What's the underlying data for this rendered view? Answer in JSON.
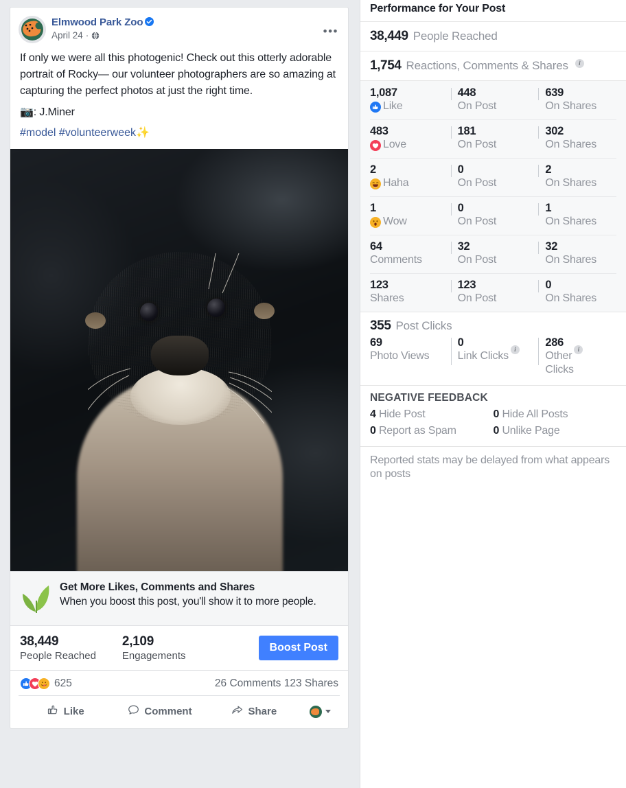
{
  "post": {
    "page_name": "Elmwood Park Zoo",
    "verified_icon": "verified-badge-icon",
    "date": "April 24",
    "separator": "·",
    "privacy_icon": "globe-icon",
    "menu_icon": "ellipsis-icon",
    "body": "If only we were all this photogenic! Check out this otterly adorable portrait of Rocky— our volunteer photographers are so amazing at capturing the perfect photos at just the right time.",
    "credit": "📷: J.Miner",
    "hashtags": "#model #volunteerweek✨",
    "photo_alt": "otter-portrait-photo"
  },
  "boost_promo": {
    "icon": "leaf-sprout-icon",
    "title": "Get More Likes, Comments and Shares",
    "subtitle": "When you boost this post, you'll show it to more people."
  },
  "summary": {
    "reach_value": "38,449",
    "reach_label": "People Reached",
    "engagements_value": "2,109",
    "engagements_label": "Engagements",
    "boost_button": "Boost Post"
  },
  "reactions_bar": {
    "icons": [
      "like-reaction-icon",
      "love-reaction-icon",
      "care-reaction-icon"
    ],
    "count": "625",
    "comments_shares": "26 Comments 123 Shares"
  },
  "actions": [
    {
      "label": "Like",
      "icon": "thumbs-up-outline-icon"
    },
    {
      "label": "Comment",
      "icon": "comment-bubble-icon"
    },
    {
      "label": "Share",
      "icon": "share-arrow-icon"
    }
  ],
  "action_avatar": {
    "icon": "profile-avatar-icon",
    "caret": "chevron-down-icon"
  },
  "insights": {
    "title": "Performance for Your Post",
    "reach": {
      "value": "38,449",
      "label": "People Reached"
    },
    "engagement": {
      "value": "1,754",
      "label": "Reactions, Comments & Shares",
      "info_icon": "info-icon"
    },
    "col_labels": {
      "on_post": "On Post",
      "on_shares": "On Shares"
    },
    "breakdown": [
      {
        "icon": "like-reaction-icon",
        "total": "1,087",
        "label": "Like",
        "on_post": "448",
        "on_shares": "639"
      },
      {
        "icon": "love-reaction-icon",
        "total": "483",
        "label": "Love",
        "on_post": "181",
        "on_shares": "302"
      },
      {
        "icon": "haha-reaction-icon",
        "total": "2",
        "label": "Haha",
        "on_post": "0",
        "on_shares": "2"
      },
      {
        "icon": "wow-reaction-icon",
        "total": "1",
        "label": "Wow",
        "on_post": "0",
        "on_shares": "1"
      },
      {
        "icon": null,
        "total": "64",
        "label": "Comments",
        "on_post": "32",
        "on_shares": "32"
      },
      {
        "icon": null,
        "total": "123",
        "label": "Shares",
        "on_post": "123",
        "on_shares": "0"
      }
    ],
    "clicks": {
      "total": "355",
      "label": "Post Clicks",
      "items": [
        {
          "value": "69",
          "label": "Photo Views",
          "info": false
        },
        {
          "value": "0",
          "label": "Link Clicks",
          "info": true
        },
        {
          "value": "286",
          "label_part1": "Other",
          "label_part2": "Clicks",
          "info": true
        }
      ]
    },
    "negative_feedback": {
      "title": "NEGATIVE FEEDBACK",
      "items": [
        {
          "value": "4",
          "label": "Hide Post"
        },
        {
          "value": "0",
          "label": "Hide All Posts"
        },
        {
          "value": "0",
          "label": "Report as Spam"
        },
        {
          "value": "0",
          "label": "Unlike Page"
        }
      ]
    },
    "note": "Reported stats may be delayed from what appears on posts"
  },
  "colors": {
    "brand_blue": "#4080ff",
    "link_blue": "#385898",
    "like_blue": "#2078f4",
    "love_red": "#f33e58",
    "haha_yellow": "#f7b125",
    "leaf_green": "#7cb342",
    "muted_gray": "#90949c"
  }
}
